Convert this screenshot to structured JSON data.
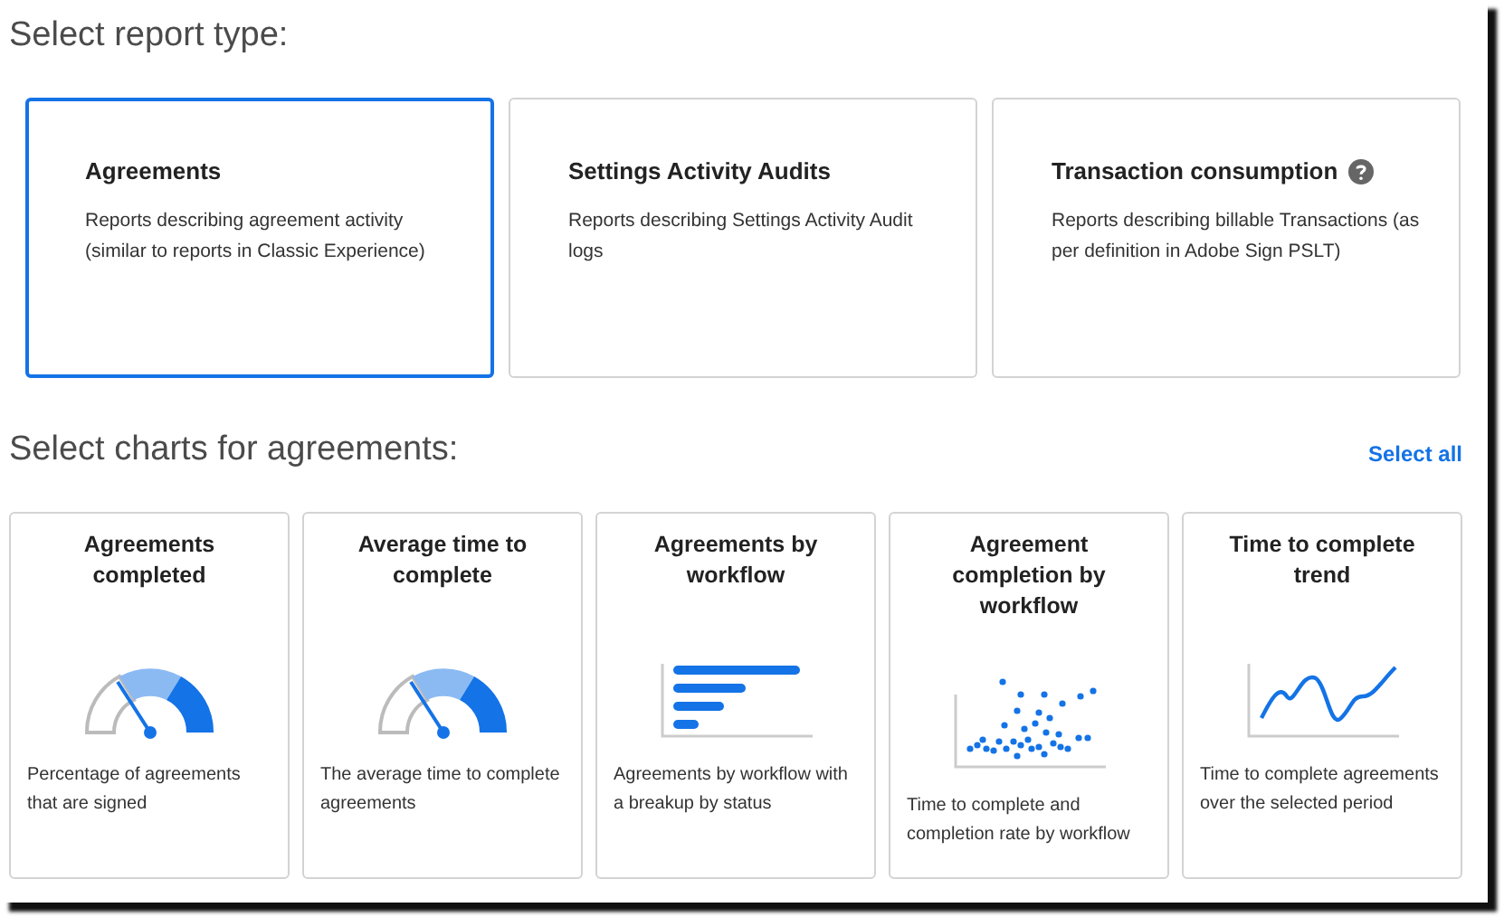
{
  "report_section": {
    "heading": "Select report type:"
  },
  "report_types": [
    {
      "title": "Agreements",
      "description": "Reports describing agreement activity (similar to reports in Classic Experience)",
      "selected": true,
      "help": false
    },
    {
      "title": "Settings Activity Audits",
      "description": "Reports describing Settings Activity Audit logs",
      "selected": false,
      "help": false
    },
    {
      "title": "Transaction consumption",
      "description": "Reports describing billable Transactions (as per definition in Adobe Sign PSLT)",
      "selected": false,
      "help": true
    }
  ],
  "charts_section": {
    "heading": "Select charts for agreements:",
    "select_all": "Select all"
  },
  "charts": [
    {
      "title": "Agreements completed",
      "kind": "gauge",
      "description": "Percentage of agreements that are signed"
    },
    {
      "title": "Average time to complete",
      "kind": "gauge",
      "description": "The average time to complete agreements"
    },
    {
      "title": "Agreements by workflow",
      "kind": "bars",
      "description": "Agreements by workflow with a breakup by status"
    },
    {
      "title": "Agreement completion by workflow",
      "kind": "scatter",
      "description": "Time to complete and completion rate by workflow"
    },
    {
      "title": "Time to complete trend",
      "kind": "line",
      "description": "Time to complete agreements over the selected period"
    }
  ]
}
